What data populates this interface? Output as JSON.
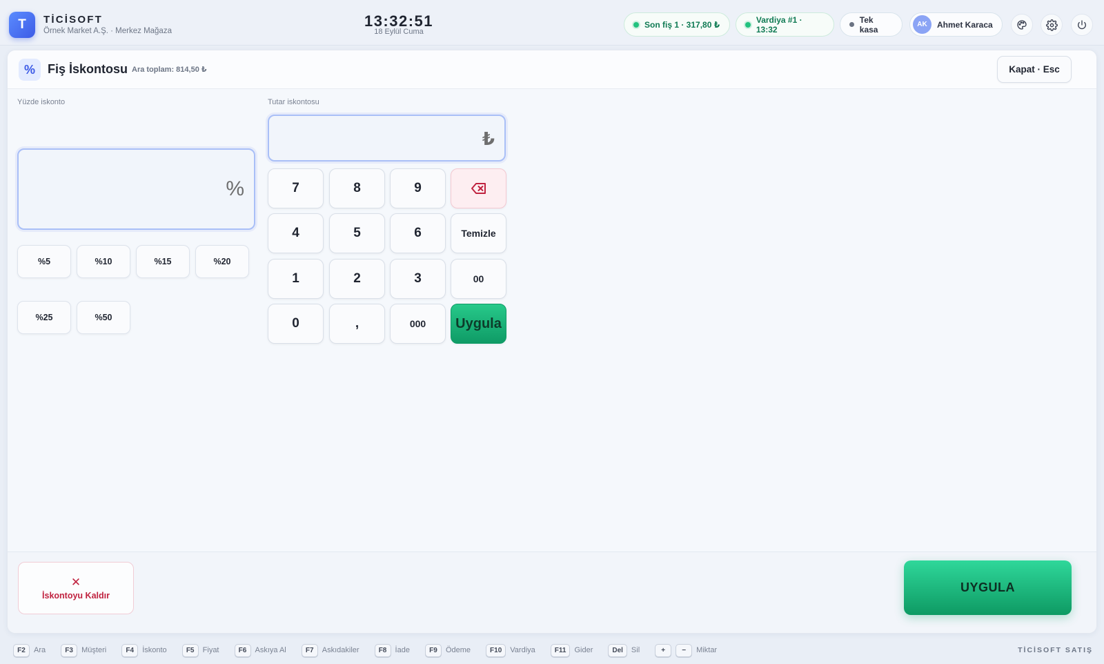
{
  "header": {
    "logo_letter": "T",
    "brand": "TİCİSOFT",
    "company": "Örnek Market A.Ş. · Merkez Mağaza",
    "clock": "13:32:51",
    "date": "18 Eylül Cuma",
    "last_receipt": "Son fiş 1 · 317,80 ₺",
    "shift": "Vardiya #1 · 13:32",
    "register": "Tek kasa",
    "user_initials": "AK",
    "user_name": "Ahmet Karaca"
  },
  "dialog": {
    "icon_text": "%",
    "title": "Fiş İskontosu",
    "subtotal": "Ara toplam: 814,50 ₺",
    "close_label": "Kapat · Esc",
    "percent_label": "Yüzde iskonto",
    "percent_unit": "%",
    "amount_label": "Tutar iskontosu",
    "amount_unit": "₺",
    "presets": [
      "%5",
      "%10",
      "%15",
      "%20",
      "%25",
      "%50"
    ],
    "keypad": {
      "k7": "7",
      "k8": "8",
      "k9": "9",
      "k4": "4",
      "k5": "5",
      "k6": "6",
      "clear": "Temizle",
      "k1": "1",
      "k2": "2",
      "k3": "3",
      "k00": "00",
      "k0": "0",
      "comma": ",",
      "k000": "000",
      "apply": "Uygula"
    },
    "remove_icon": "✕",
    "remove_label": "İskontoyu Kaldır",
    "apply_label": "UYGULA"
  },
  "shortcuts": [
    {
      "key": "F2",
      "label": "Ara"
    },
    {
      "key": "F3",
      "label": "Müşteri"
    },
    {
      "key": "F4",
      "label": "İskonto"
    },
    {
      "key": "F5",
      "label": "Fiyat"
    },
    {
      "key": "F6",
      "label": "Askıya Al"
    },
    {
      "key": "F7",
      "label": "Askıdakiler"
    },
    {
      "key": "F8",
      "label": "İade"
    },
    {
      "key": "F9",
      "label": "Ödeme"
    },
    {
      "key": "F10",
      "label": "Vardiya"
    },
    {
      "key": "F11",
      "label": "Gider"
    },
    {
      "key": "Del",
      "label": "Sil"
    }
  ],
  "qty_shortcut": {
    "plus": "+",
    "minus": "−",
    "label": "Miktar"
  },
  "footer_brand": "TİCİSOFT SATIŞ",
  "colors": {
    "accent": "#3d5be6",
    "success": "#22c27f",
    "danger": "#c0223f"
  }
}
